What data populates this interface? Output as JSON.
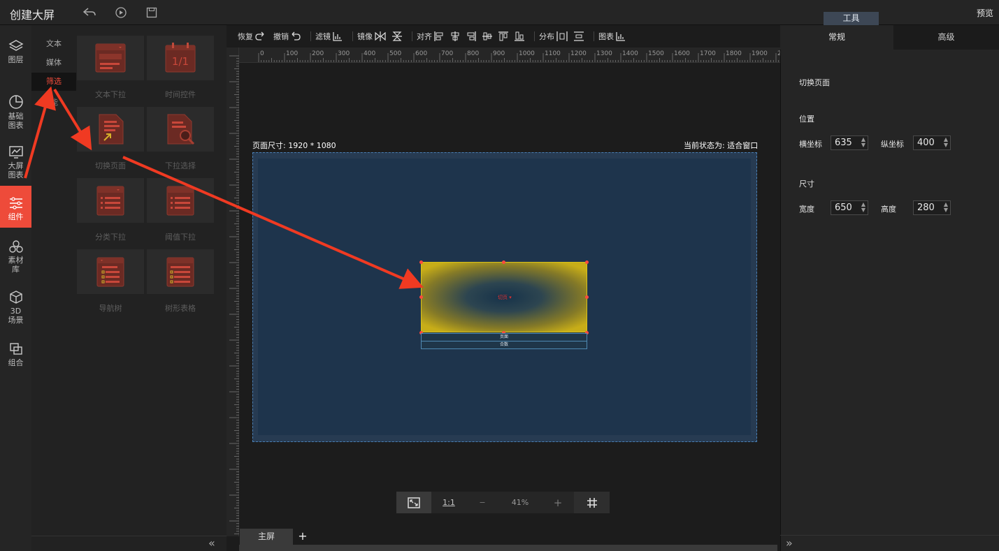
{
  "app": {
    "title": "创建大屏",
    "tools_tab": "工具",
    "preview": "预览"
  },
  "nav": [
    {
      "label": "图层",
      "icon": "layers-icon"
    },
    {
      "label": "基础图表",
      "icon": "pie-chart-icon"
    },
    {
      "label": "大屏图表",
      "icon": "monitor-chart-icon"
    },
    {
      "label": "组件",
      "icon": "sliders-icon",
      "active": true
    },
    {
      "label": "素材库",
      "icon": "materials-icon"
    },
    {
      "label": "3D场景",
      "icon": "cube-icon"
    },
    {
      "label": "组合",
      "icon": "group-icon"
    }
  ],
  "subtabs": [
    "文本",
    "媒体",
    "筛选"
  ],
  "subtab_partial": "能",
  "components": [
    {
      "label": "文本下拉"
    },
    {
      "label": "时间控件"
    },
    {
      "label": "切换页面"
    },
    {
      "label": "下拉选择"
    },
    {
      "label": "分类下拉"
    },
    {
      "label": "阈值下拉"
    },
    {
      "label": "导航树"
    },
    {
      "label": "树形表格"
    }
  ],
  "toolbar": {
    "redo": "恢复",
    "undo": "撤销",
    "filter": "滤镜",
    "mirror": "镜像",
    "align": "对齐",
    "distribute": "分布",
    "chart": "图表"
  },
  "ruler_ticks": [
    "0",
    "100",
    "200",
    "300",
    "400",
    "500",
    "600",
    "700",
    "800",
    "900",
    "1000",
    "1100",
    "1200",
    "1300",
    "1400",
    "1500",
    "1600",
    "1700",
    "1800",
    "1900",
    "20"
  ],
  "canvas": {
    "page_size": "页面尺寸: 1920 * 1080",
    "state": "当前状态为: 适合窗口",
    "widget_label": "切页",
    "options": [
      "页面",
      "合数"
    ]
  },
  "zoom": {
    "ratio": "1:1",
    "minus": "−",
    "value": "41%",
    "plus": "+"
  },
  "screens": {
    "main": "主屏",
    "add": "+"
  },
  "right": {
    "tab_normal": "常规",
    "tab_advanced": "高级",
    "switch_page": "切换页面",
    "position": "位置",
    "x_label": "横坐标",
    "x": "635",
    "y_label": "纵坐标",
    "y": "400",
    "size": "尺寸",
    "w_label": "宽度",
    "w": "650",
    "h_label": "高度",
    "h": "280"
  },
  "colors": {
    "accent": "#ee4b3a",
    "highlight": "#d8c11b",
    "page_bg": "#1e344c"
  }
}
